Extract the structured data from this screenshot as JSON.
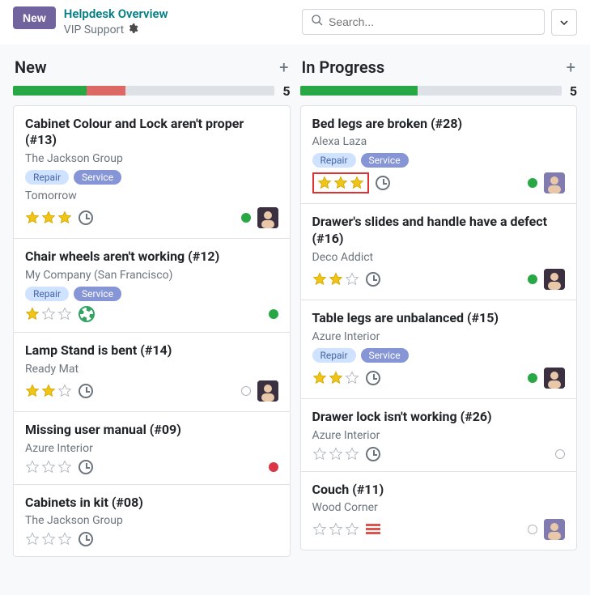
{
  "header": {
    "new_button": "New",
    "breadcrumb_top": "Helpdesk Overview",
    "breadcrumb_sub": "VIP Support",
    "search_placeholder": "Search..."
  },
  "columns": [
    {
      "title": "New",
      "count": "5",
      "progress": [
        {
          "color": "green",
          "pct": 28
        },
        {
          "color": "red",
          "pct": 15
        },
        {
          "color": "grey",
          "pct": 57
        }
      ],
      "cards": [
        {
          "title": "Cabinet Colour and Lock aren't proper (#13)",
          "subtitle": "The Jackson Group",
          "tags": [
            "Repair",
            "Service"
          ],
          "deadline": "Tomorrow",
          "stars": 3,
          "statusDot": "green",
          "avatar": "dark",
          "highlight": false
        },
        {
          "title": "Chair wheels aren't working (#12)",
          "subtitle": "My Company (San Francisco)",
          "tags": [
            "Repair",
            "Service"
          ],
          "stars": 1,
          "extraIcon": "life",
          "statusDot": "green",
          "avatar": null,
          "highlight": false
        },
        {
          "title": "Lamp Stand is bent (#14)",
          "subtitle": "Ready Mat",
          "tags": [],
          "stars": 2,
          "statusDot": "grey",
          "avatar": "dark",
          "highlight": false
        },
        {
          "title": "Missing user manual (#09)",
          "subtitle": "Azure Interior",
          "tags": [],
          "stars": 0,
          "statusDot": "red",
          "avatar": null,
          "highlight": false
        },
        {
          "title": "Cabinets in kit (#08)",
          "subtitle": "The Jackson Group",
          "tags": [],
          "stars": 0,
          "statusDot": null,
          "avatar": null,
          "highlight": false
        }
      ]
    },
    {
      "title": "In Progress",
      "count": "5",
      "progress": [
        {
          "color": "green",
          "pct": 45
        },
        {
          "color": "grey",
          "pct": 55
        }
      ],
      "cards": [
        {
          "title": "Bed legs are broken (#28)",
          "subtitle": "Alexa Laza",
          "tags": [
            "Repair",
            "Service"
          ],
          "stars": 3,
          "statusDot": "green",
          "avatar": "alt",
          "highlight": true
        },
        {
          "title": "Drawer's slides and handle have a defect (#16)",
          "subtitle": "Deco Addict",
          "tags": [],
          "stars": 2,
          "statusDot": "green",
          "avatar": "dark",
          "highlight": false
        },
        {
          "title": "Table legs are unbalanced (#15)",
          "subtitle": "Azure Interior",
          "tags": [
            "Repair",
            "Service"
          ],
          "stars": 2,
          "statusDot": "green",
          "avatar": "dark",
          "highlight": false
        },
        {
          "title": "Drawer lock isn't working (#26)",
          "subtitle": "Azure Interior",
          "tags": [],
          "stars": 0,
          "statusDot": "grey",
          "avatar": null,
          "highlight": false
        },
        {
          "title": "Couch (#11)",
          "subtitle": "Wood Corner",
          "tags": [],
          "stars": 0,
          "extraIcon": "list",
          "statusDot": "grey",
          "avatar": "alt",
          "highlight": false
        }
      ]
    }
  ]
}
